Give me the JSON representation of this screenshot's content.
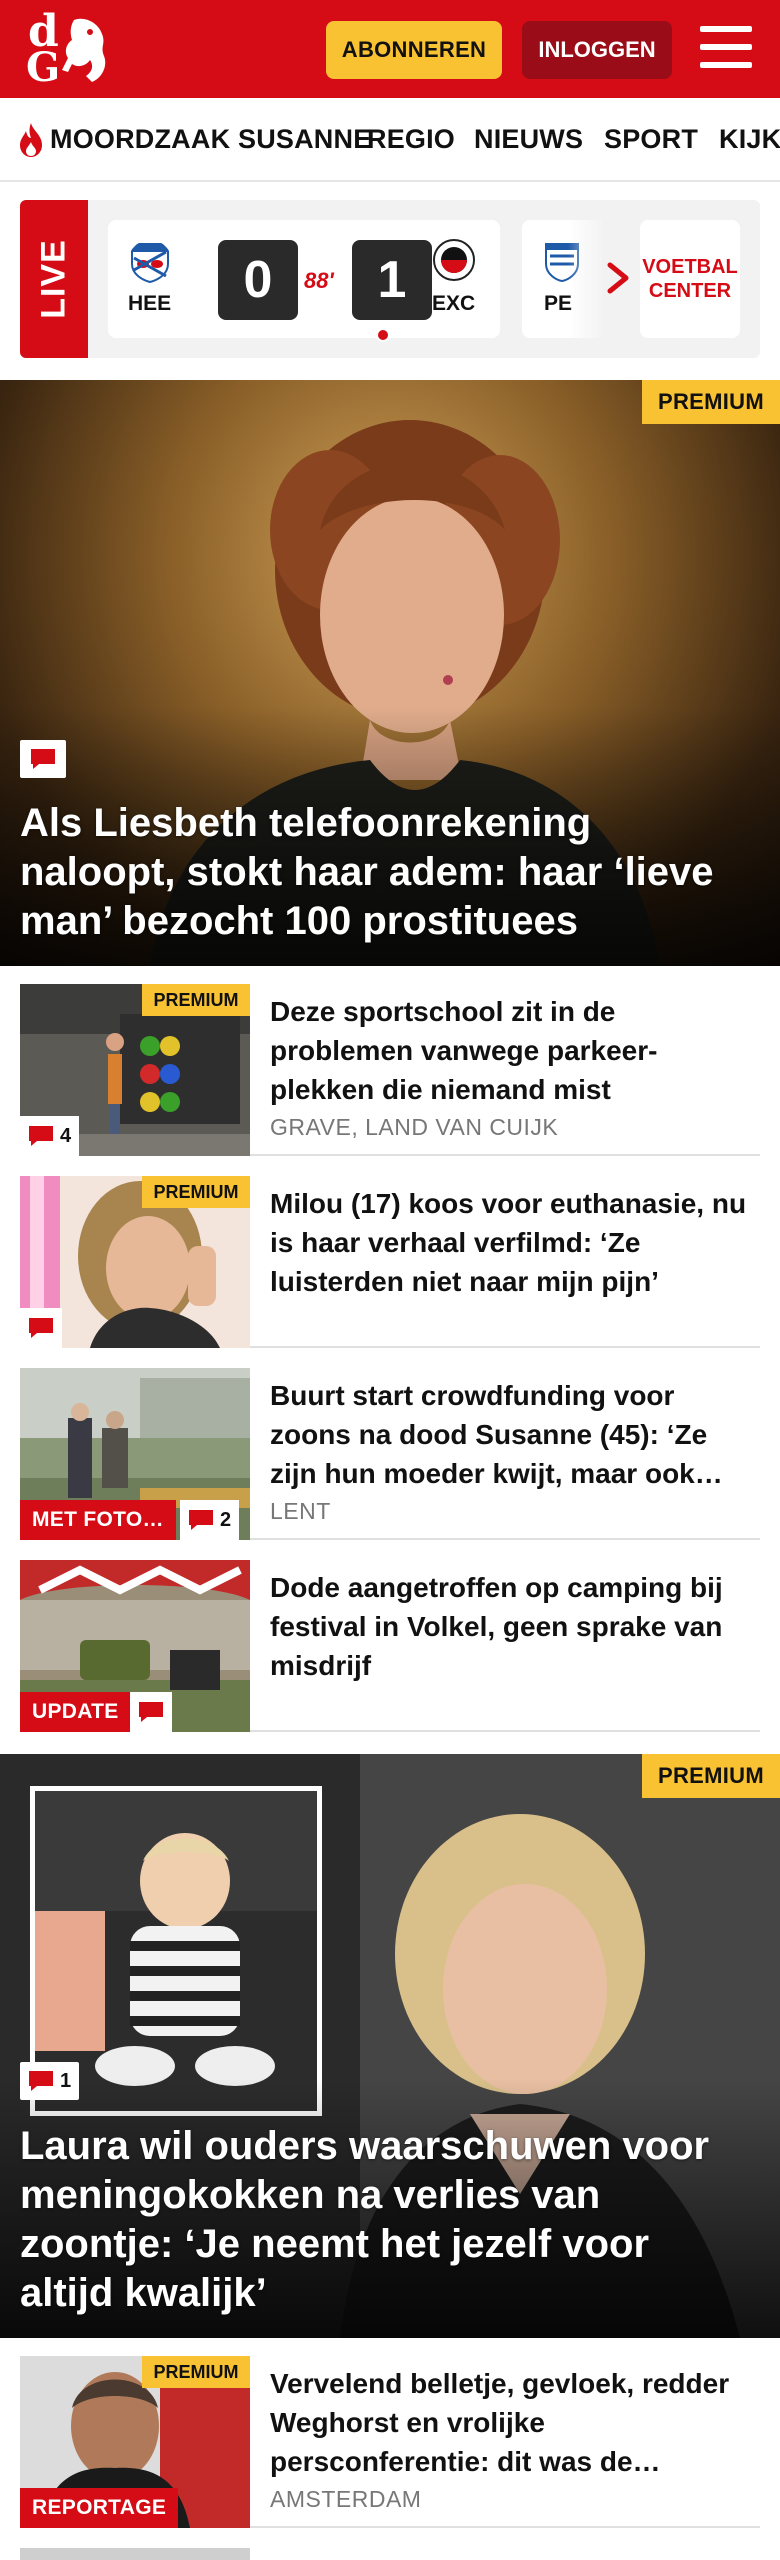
{
  "header": {
    "logo_letters": [
      "d",
      "G"
    ],
    "subscribe_label": "ABONNEREN",
    "login_label": "INLOGGEN",
    "brand_color": "#d50c16",
    "accent_color": "#f9c233"
  },
  "nav": {
    "items": [
      "MOORDZAAK SUSANNE",
      "REGIO",
      "NIEUWS",
      "SPORT",
      "KIJK"
    ]
  },
  "live": {
    "label": "LIVE",
    "match": {
      "home_code": "HEE",
      "home_score": "0",
      "minute": "88'",
      "away_score": "1",
      "away_code": "EXC"
    },
    "next_match_code": "PE",
    "voetbal_center": [
      "VOETBAL",
      "CENTER"
    ]
  },
  "hero1": {
    "premium": "PREMIUM",
    "title": "Als Liesbeth telefoonrekening naloopt, stokt haar adem: haar ‘lieve man’ bezocht 100 prostituees"
  },
  "articles": [
    {
      "premium": "PREMIUM",
      "title": "Deze sportschool zit in de problemen vanwege parkeer­plekken die niemand mist",
      "location": "GRAVE, LAND VAN CUIJK",
      "comments": "4"
    },
    {
      "premium": "PREMIUM",
      "title": "Milou (17) koos voor euthanasie, nu is haar verhaal verfilmd: ‘Ze luisterden niet naar mijn pijn’"
    },
    {
      "title": "Buurt start crowdfunding voor zoons na dood Susanne (45): ‘Ze zijn hun moeder kwijt, maar ook…",
      "location": "LENT",
      "label": "MET FOTO…",
      "comments": "2"
    },
    {
      "title": "Dode aangetroffen op camping bij festival in Volkel, geen sprake van misdrijf",
      "label": "UPDATE"
    }
  ],
  "hero2": {
    "premium": "PREMIUM",
    "comments": "1",
    "title": "Laura wil ouders waarschuwen voor meningokokken na verlies van zoontje: ‘Je neemt het jezelf voor altijd kwalijk’"
  },
  "article_bottom": {
    "premium": "PREMIUM",
    "title": "Vervelend belletje, gevloek, redder Weghorst en vrolijke persconferentie: dit was de…",
    "location": "AMSTERDAM",
    "label": "REPORTAGE"
  }
}
